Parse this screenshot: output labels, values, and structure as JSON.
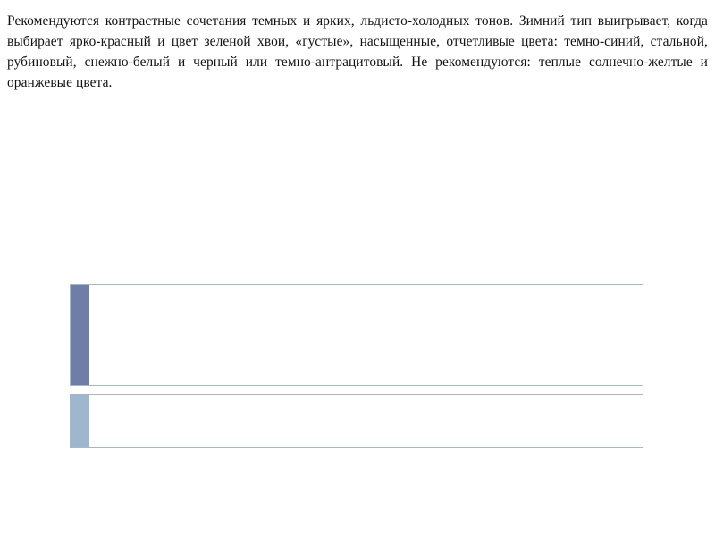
{
  "text": {
    "paragraph": "Рекомендуются контрастные сочетания темных и ярких, льдисто-холодных тонов. Зимний тип выигрывает, когда выбирает ярко-красный и цвет зеленой хвои, «густые», насыщенные, отчетливые цвета: темно-синий, стальной, рубиновый, снежно-белый и черный или темно-антрацитовый. Не рекомендуются: теплые солнечно-желтые и оранжевые цвета."
  },
  "colors": {
    "accent_dark": "#6f7ea6",
    "accent_light": "#9fb6cf",
    "card_border": "#a6b6cc",
    "text": "#111111"
  }
}
